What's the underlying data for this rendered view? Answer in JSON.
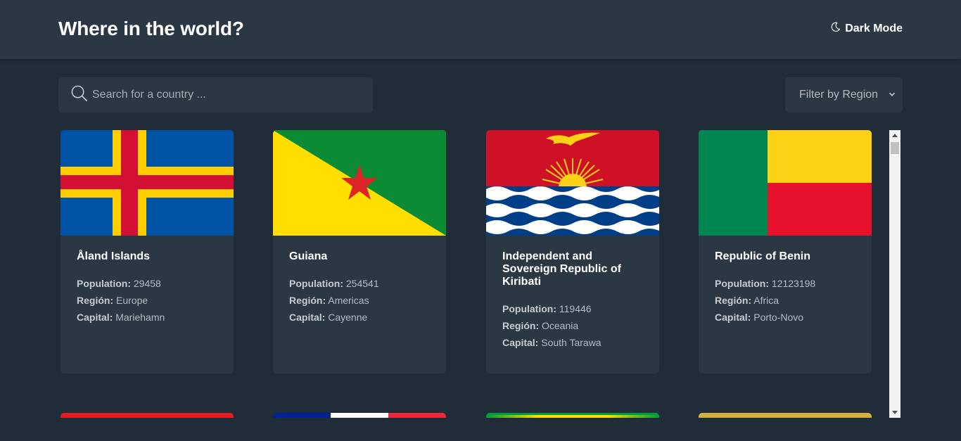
{
  "header": {
    "title": "Where in the world?",
    "dark_mode_label": "Dark Mode",
    "dark_mode_icon": "moon-icon"
  },
  "search": {
    "placeholder": "Search for a country ...",
    "value": "",
    "icon": "search-icon"
  },
  "filter": {
    "selected": "Filter by Region",
    "icon": "chevron-down-icon"
  },
  "labels": {
    "population": "Population:",
    "region": "Región:",
    "capital": "Capital:"
  },
  "countries": [
    {
      "name": "Åland Islands",
      "population": "29458",
      "region": "Europe",
      "capital": "Mariehamn",
      "flag": "aland-flag"
    },
    {
      "name": "Guiana",
      "population": "254541",
      "region": "Americas",
      "capital": "Cayenne",
      "flag": "french-guiana-flag"
    },
    {
      "name": "Independent and Sovereign Republic of Kiribati",
      "population": "119446",
      "region": "Oceania",
      "capital": "South Tarawa",
      "flag": "kiribati-flag"
    },
    {
      "name": "Republic of Benin",
      "population": "12123198",
      "region": "Africa",
      "capital": "Porto-Novo",
      "flag": "benin-flag"
    }
  ],
  "partial_cards": [
    "red-flag",
    "france-flag",
    "brazil-flag",
    "gold-flag"
  ],
  "colors": {
    "background": "#202c37",
    "elements": "#2b3743",
    "text": "#ffffff"
  }
}
